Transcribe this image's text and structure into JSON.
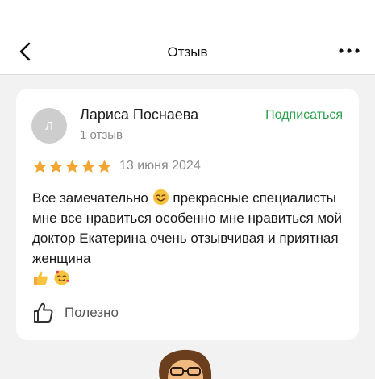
{
  "header": {
    "title": "Отзыв",
    "back_icon": "chevron-left-icon",
    "menu_icon": "more-horizontal-icon"
  },
  "review": {
    "avatar_initial": "Л",
    "author": "Лариса Поснаева",
    "reviews_count": "1 отзыв",
    "subscribe_label": "Подписаться",
    "rating": 5,
    "rating_max": 5,
    "date": "13 июня 2024",
    "text_line1": "Все замечательно",
    "text_line2": "прекрасные специалисты мне все нравиться особенно мне нравиться мой доктор Екатерина очень отзывчивая и приятная женщина",
    "emojis": [
      "smiling-face-icon",
      "thumbs-up-icon",
      "smiling-face-with-hearts-icon"
    ],
    "helpful_label": "Полезно"
  },
  "colors": {
    "accent_green": "#2ca24c",
    "star": "#f2a531",
    "secondary_text": "#8a8a8a",
    "background": "#f2f2f2"
  }
}
